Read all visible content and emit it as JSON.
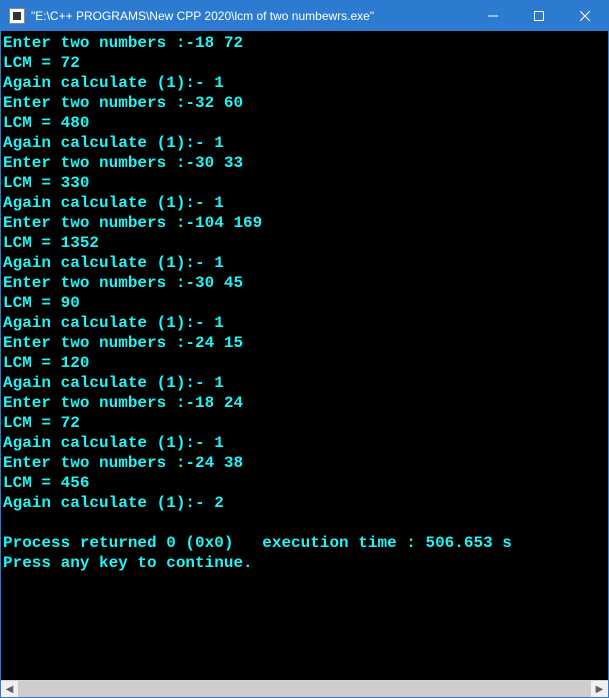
{
  "window": {
    "title": "\"E:\\C++ PROGRAMS\\New CPP 2020\\lcm of two numbewrs.exe\""
  },
  "console": {
    "lines": [
      "Enter two numbers :-18 72",
      "LCM = 72",
      "Again calculate (1):- 1",
      "Enter two numbers :-32 60",
      "LCM = 480",
      "Again calculate (1):- 1",
      "Enter two numbers :-30 33",
      "LCM = 330",
      "Again calculate (1):- 1",
      "Enter two numbers :-104 169",
      "LCM = 1352",
      "Again calculate (1):- 1",
      "Enter two numbers :-30 45",
      "LCM = 90",
      "Again calculate (1):- 1",
      "Enter two numbers :-24 15",
      "LCM = 120",
      "Again calculate (1):- 1",
      "Enter two numbers :-18 24",
      "LCM = 72",
      "Again calculate (1):- 1",
      "Enter two numbers :-24 38",
      "LCM = 456",
      "Again calculate (1):- 2",
      "",
      "Process returned 0 (0x0)   execution time : 506.653 s",
      "Press any key to continue."
    ]
  },
  "scroll": {
    "left_glyph": "◀",
    "right_glyph": "▶"
  }
}
